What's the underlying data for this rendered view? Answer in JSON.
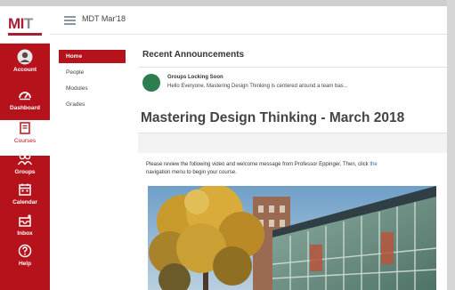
{
  "brand": {
    "logo_main": "MI",
    "logo_accent": "T",
    "primary": "#b5121b",
    "active_text": "#b5121b"
  },
  "global_nav": {
    "items": [
      {
        "label": "Account",
        "icon": "user-avatar-icon"
      },
      {
        "label": "Dashboard",
        "icon": "dashboard-gauge-icon"
      },
      {
        "label": "Courses",
        "icon": "book-icon"
      },
      {
        "label": "Groups",
        "icon": "groups-icon"
      },
      {
        "label": "Calendar",
        "icon": "calendar-icon"
      },
      {
        "label": "Inbox",
        "icon": "inbox-icon"
      },
      {
        "label": "Help",
        "icon": "help-icon"
      }
    ]
  },
  "course_header": {
    "title": "MDT Mar'18"
  },
  "course_nav": {
    "items": [
      "Home",
      "People",
      "Modules",
      "Grades"
    ]
  },
  "announcements": {
    "heading": "Recent Announcements",
    "items": [
      {
        "title": "Groups Locking Soon",
        "excerpt": "Hello Everyone, Mastering Design Thinking is centered around a team bas..."
      }
    ]
  },
  "page": {
    "title": "Mastering Design Thinking - March 2018",
    "intro_text": "Please review the following video and welcome message from Professor Eppinger. Then, click",
    "intro_link": "the",
    "intro_text_2": "navigation menu to begin your course."
  }
}
